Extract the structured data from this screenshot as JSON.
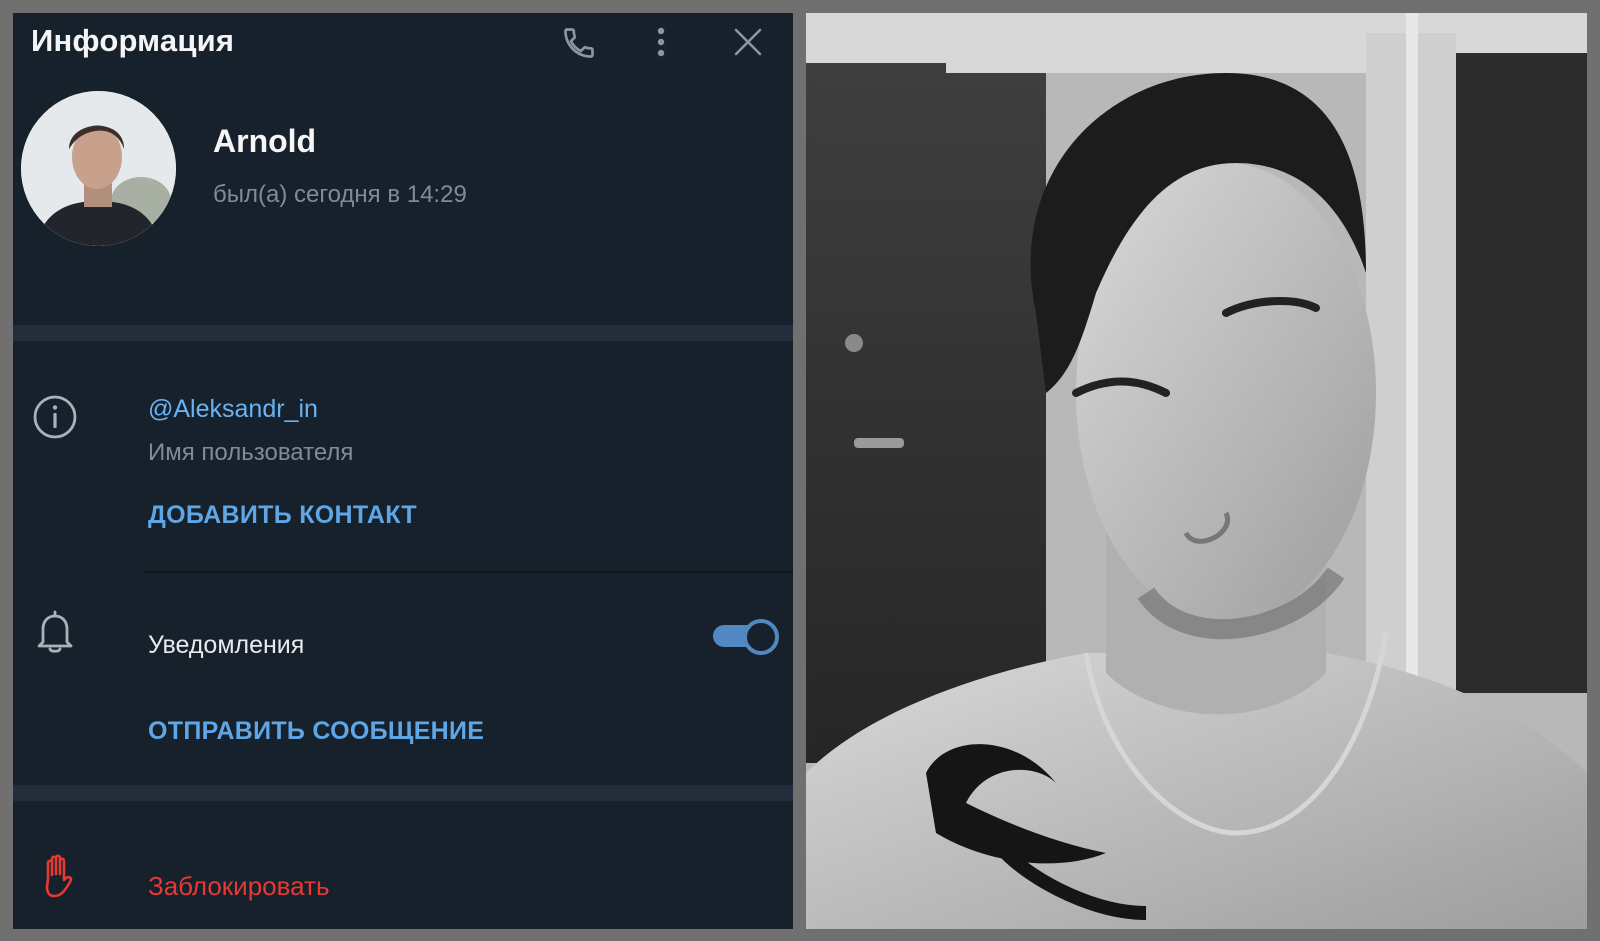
{
  "header": {
    "title": "Информация",
    "icons": [
      "phone-icon",
      "more-vertical-icon",
      "close-icon"
    ]
  },
  "profile": {
    "name": "Arnold",
    "last_seen": "был(а) сегодня в 14:29"
  },
  "info": {
    "username": "@Aleksandr_in",
    "username_label": "Имя пользователя",
    "add_contact": "ДОБАВИТЬ КОНТАКТ"
  },
  "notifications": {
    "label": "Уведомления",
    "enabled": true,
    "send_message": "ОТПРАВИТЬ СООБЩЕНИЕ"
  },
  "block": {
    "label": "Заблокировать"
  },
  "colors": {
    "panel_bg": "#17212b",
    "separator": "#232e3c",
    "accent_blue": "#5ea6e6",
    "toggle_on": "#5288c1",
    "danger_red": "#e53935",
    "muted_text": "#7f8b97"
  }
}
